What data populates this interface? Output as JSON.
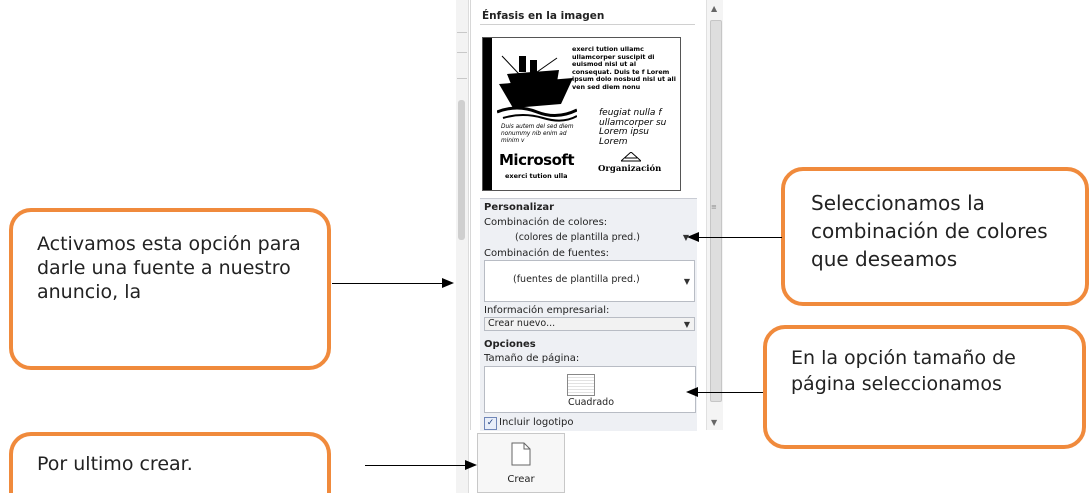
{
  "panel": {
    "title": "Énfasis en la imagen",
    "preview": {
      "top_text": "exerci tution ullamc ullamcorper suscipit di euismod nisl ut al consequat. Duis te f Lorem ipsum dolo nosbud nisl ut ali ven sed diem nonu",
      "italic_right": "feugiat nulla f ullamcorper su Lorem ipsu Lorem",
      "italic_left": "Duis autem del sed diem nonummy nib enim ad minim v",
      "brand": "Microsoft",
      "brand_sub": "exerci tution ulla",
      "org": "Organización"
    },
    "personalizar": {
      "heading": "Personalizar",
      "colors_label": "Combinación de colores:",
      "colors_value": "(colores de plantilla pred.)",
      "fonts_label": "Combinación de fuentes:",
      "fonts_value": "(fuentes de plantilla pred.)",
      "business_label": "Información empresarial:",
      "business_value": "Crear nuevo..."
    },
    "opciones": {
      "heading": "Opciones",
      "size_label": "Tamaño de página:",
      "size_value": "Cuadrado",
      "logo_label": "Incluir logotipo"
    },
    "create_label": "Crear"
  },
  "callouts": {
    "left": "Activamos esta opción para darle una fuente a nuestro anuncio, la",
    "right_top": "Seleccionamos la combinación de colores que deseamos",
    "right_bottom": "En la opción tamaño de página seleccionamos",
    "bottom_left": "Por ultimo crear."
  }
}
